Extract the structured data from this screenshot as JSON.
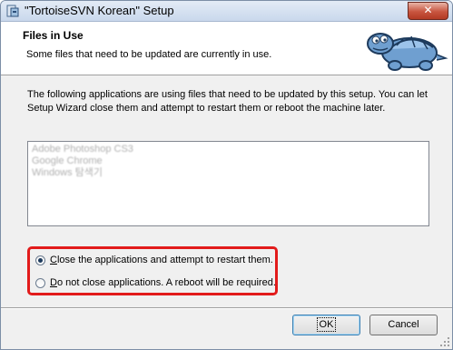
{
  "window": {
    "title": "\"TortoiseSVN Korean\" Setup",
    "close_label": "✕"
  },
  "banner": {
    "title": "Files in Use",
    "description": "Some files that need to be updated are currently in use."
  },
  "intro_text": "The following applications are using files that need to be updated by this setup. You can let Setup Wizard close them and attempt to restart them or reboot the machine later.",
  "applications": [
    "Adobe Photoshop CS3",
    "Google Chrome",
    "Windows 탐색기"
  ],
  "options": {
    "close_restart": {
      "mnemonic": "C",
      "rest": "lose the applications and attempt to restart them.",
      "selected": true
    },
    "do_not_close": {
      "mnemonic": "D",
      "rest": "o not close applications. A reboot will be required.",
      "selected": false
    }
  },
  "buttons": {
    "ok": "OK",
    "cancel": "Cancel"
  },
  "colors": {
    "highlight": "#e21b1b",
    "titlebar": "#c9d8ec"
  },
  "icons": {
    "title": "setup-installer-icon",
    "banner": "tortoise-mascot-icon"
  }
}
